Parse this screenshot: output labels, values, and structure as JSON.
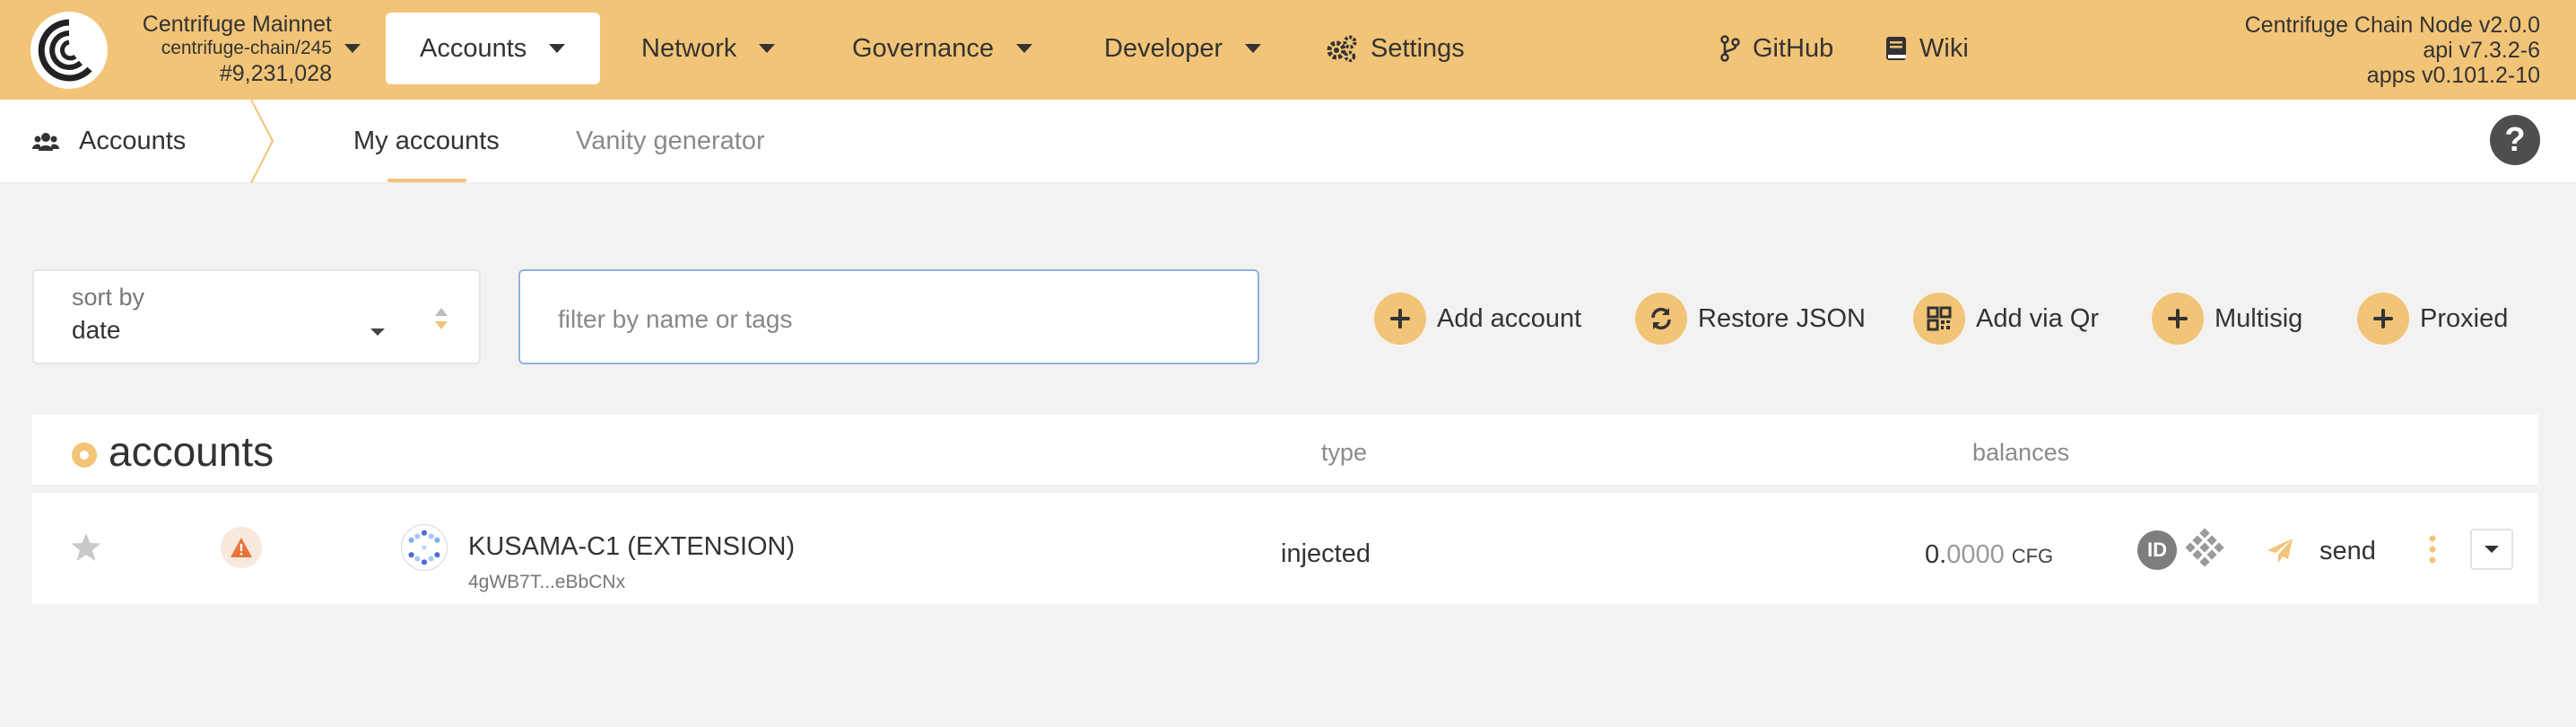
{
  "topbar": {
    "chain_name": "Centrifuge Mainnet",
    "chain_spec": "centrifuge-chain/245",
    "block": "#9,231,028",
    "nav": [
      {
        "label": "Accounts",
        "icon": "chevron-down-icon"
      },
      {
        "label": "Network",
        "icon": "chevron-down-icon"
      },
      {
        "label": "Governance",
        "icon": "chevron-down-icon"
      },
      {
        "label": "Developer",
        "icon": "chevron-down-icon"
      },
      {
        "label": "Settings",
        "icon": "gears-icon"
      },
      {
        "label": "GitHub",
        "icon": "code-branch-icon"
      },
      {
        "label": "Wiki",
        "icon": "book-icon"
      }
    ],
    "node_version": "Centrifuge Chain Node v2.0.0",
    "api_version": "api v7.3.2-6",
    "apps_version": "apps v0.101.2-10"
  },
  "subnav": {
    "section": "Accounts",
    "tabs": [
      {
        "label": "My accounts",
        "active": true
      },
      {
        "label": "Vanity generator",
        "active": false
      }
    ],
    "help_icon": "question-circle-icon"
  },
  "controls": {
    "sort_label": "sort by",
    "sort_value": "date",
    "filter_placeholder": "filter by name or tags",
    "actions": [
      {
        "label": "Add account",
        "icon": "plus-icon"
      },
      {
        "label": "Restore JSON",
        "icon": "sync-icon"
      },
      {
        "label": "Add via Qr",
        "icon": "qrcode-icon"
      },
      {
        "label": "Multisig",
        "icon": "plus-icon"
      },
      {
        "label": "Proxied",
        "icon": "plus-icon"
      }
    ]
  },
  "table": {
    "title": "accounts",
    "columns": {
      "type": "type",
      "balances": "balances"
    },
    "rows": [
      {
        "name": "KUSAMA-C1 (EXTENSION)",
        "address": "4gWB7T...eBbCNx",
        "type": "injected",
        "balance_int": "0.",
        "balance_dec": "0000",
        "balance_unit": "CFG",
        "id_badge": "ID",
        "send_label": "send"
      }
    ]
  },
  "colors": {
    "accent": "#f2c477",
    "background": "#f3f2f1",
    "text": "#333333",
    "muted": "#8a8a8a",
    "warning": "#e8743b"
  }
}
